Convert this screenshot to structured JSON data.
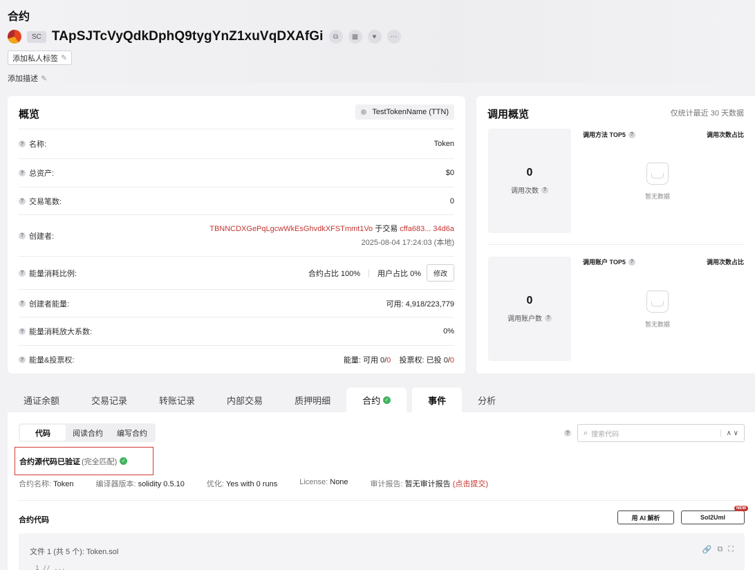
{
  "page": {
    "title": "合约"
  },
  "contract": {
    "type_badge": "SC",
    "address": "TApSJTcVyQdkDphQ9tygYnZ1xuVqDXAfGi",
    "add_tag_label": "添加私人标签",
    "add_desc_label": "添加描述"
  },
  "overview": {
    "title": "概览",
    "token_chip": "TestTokenName (TTN)",
    "rows": {
      "name": {
        "label": "名称:",
        "value": "Token"
      },
      "assets": {
        "label": "总资产:",
        "value": "$0"
      },
      "tx_count": {
        "label": "交易笔数:",
        "value": "0"
      },
      "creator": {
        "label": "创建者:",
        "address": "TBNNCDXGePqLgcwWkEsGhvdkXFSTmmt1Vo",
        "at_tx": "于交易",
        "tx_hash": "cffa683... 34d6a",
        "time": "2025-08-04 17:24:03 (本地)"
      },
      "energy_ratio": {
        "label": "能量消耗比例:",
        "contract_share": "合约占比 100%",
        "user_share": "用户占比 0%",
        "edit_label": "修改"
      },
      "creator_energy": {
        "label": "创建者能量:",
        "value": "可用:  4,918/223,779"
      },
      "energy_factor": {
        "label": "能量消耗放大系数:",
        "value": "0%"
      },
      "energy_votes": {
        "label": "能量&投票权:",
        "energy_prefix": "能量: 可用 0/",
        "energy_red": "0",
        "votes_prefix": "投票权: 已投 0/",
        "votes_red": "0"
      }
    }
  },
  "calls": {
    "title": "调用概览",
    "note": "仅统计最近 30 天数据",
    "call_count": {
      "value": "0",
      "label": "调用次数"
    },
    "method_head": "调用方法 TOP5",
    "ratio_head": "调用次数占比",
    "account_count": {
      "value": "0",
      "label": "调用账户数"
    },
    "account_head": "调用账户 TOP5",
    "ratio_head2": "调用次数占比",
    "empty_text": "暂无数据"
  },
  "tabs": {
    "balance": "通证余额",
    "transactions": "交易记录",
    "transfers": "转账记录",
    "internal": "内部交易",
    "stake": "质押明细",
    "contract": "合约",
    "events": "事件",
    "analysis": "分析"
  },
  "contract_tab": {
    "seg": {
      "code": "代码",
      "read": "阅读合约",
      "write": "编写合约"
    },
    "search_placeholder": "搜索代码",
    "verified_label": "合约源代码已验证",
    "verified_match": "(完全匹配)",
    "info": {
      "name_k": "合约名称:",
      "name_v": "Token",
      "compiler_k": "编译器版本:",
      "compiler_v": "solidity 0.5.10",
      "opt_k": "优化:",
      "opt_v": "Yes with 0 runs",
      "license_k": "License:",
      "license_v": "None",
      "audit_k": "审计报告:",
      "audit_v": "暂无审计报告",
      "audit_link": "(点击提交)"
    },
    "code_title": "合约代码",
    "ai_btn": "用 AI 解析",
    "uml_btn": "Sol2Uml",
    "new_badge": "NEW",
    "file_name": "文件 1 (共 5 个): Token.sol"
  },
  "colors": {
    "accent_red": "#c23631",
    "verified_green": "#41b45e"
  }
}
